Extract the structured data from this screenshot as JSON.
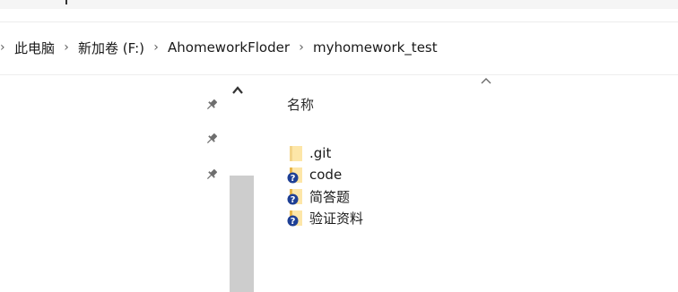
{
  "breadcrumb": {
    "items": [
      {
        "label": "此电脑"
      },
      {
        "label": "新加卷 (F:)"
      },
      {
        "label": "AhomeworkFloder"
      },
      {
        "label": "myhomework_test"
      }
    ],
    "separator": "›"
  },
  "content": {
    "column_header": "名称",
    "sort_direction": "ascending",
    "files": [
      {
        "name": ".git",
        "icon": "folder-icon",
        "status_overlay": null
      },
      {
        "name": "code",
        "icon": "folder-icon",
        "status_overlay": "question-overlay-icon"
      },
      {
        "name": "简答题",
        "icon": "folder-icon",
        "status_overlay": "question-overlay-icon"
      },
      {
        "name": "验证资料",
        "icon": "folder-icon",
        "status_overlay": "question-overlay-icon"
      }
    ]
  },
  "nav_pane": {
    "pinned_count": 3
  },
  "colors": {
    "folder_light": "#fde6a8",
    "folder_dark": "#e8b64a",
    "overlay_blue": "#1e3f95",
    "scrollbar": "#cdcdcd"
  }
}
